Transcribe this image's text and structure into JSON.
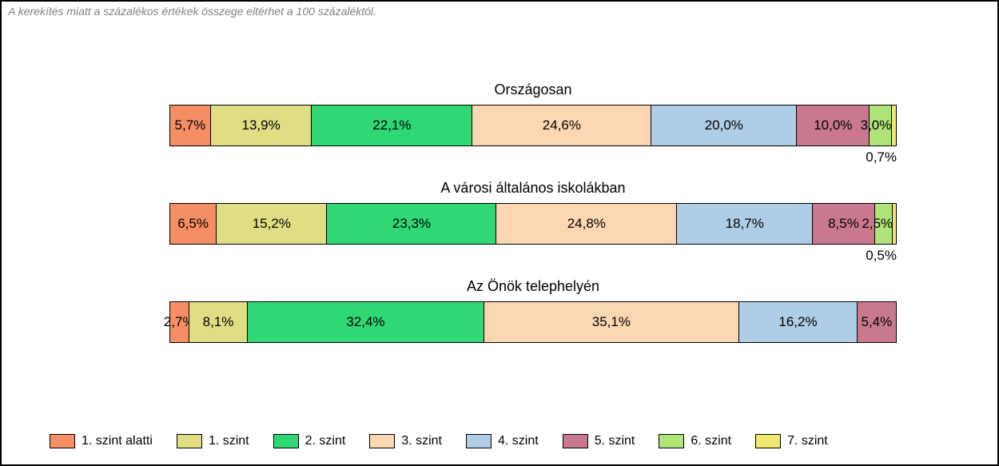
{
  "note": "A kerekítés miatt a százalékos értékek összege eltérhet a 100 százaléktól.",
  "levels": [
    {
      "name": "1. szint alatti",
      "color": "#f58e65"
    },
    {
      "name": "1. szint",
      "color": "#e0dd85"
    },
    {
      "name": "2. szint",
      "color": "#2fd875"
    },
    {
      "name": "3. szint",
      "color": "#fbd6b2"
    },
    {
      "name": "4. szint",
      "color": "#afcde6"
    },
    {
      "name": "5. szint",
      "color": "#ca7890"
    },
    {
      "name": "6. szint",
      "color": "#aee47a"
    },
    {
      "name": "7. szint",
      "color": "#efe86f"
    }
  ],
  "rows": [
    {
      "title": "Országosan",
      "values": [
        5.7,
        13.9,
        22.1,
        24.6,
        20.0,
        10.0,
        3.0,
        0.7
      ],
      "labels": [
        "5,7%",
        "13,9%",
        "22,1%",
        "24,6%",
        "20,0%",
        "10,0%",
        "3,0%",
        "0,7%"
      ],
      "overflowIndexFrom": 6
    },
    {
      "title": "A városi általános iskolákban",
      "values": [
        6.5,
        15.2,
        23.3,
        24.8,
        18.7,
        8.5,
        2.5,
        0.5
      ],
      "labels": [
        "6,5%",
        "15,2%",
        "23,3%",
        "24,8%",
        "18,7%",
        "8,5%",
        "2,5%",
        "0,5%"
      ],
      "overflowIndexFrom": 6
    },
    {
      "title": "Az Önök telephelyén",
      "values": [
        2.7,
        8.1,
        32.4,
        35.1,
        16.2,
        5.4
      ],
      "labels": [
        "2,7%",
        "8,1%",
        "32,4%",
        "35,1%",
        "16,2%",
        "5,4%"
      ],
      "overflowIndexFrom": 99
    }
  ],
  "chart_data": {
    "type": "bar",
    "stacked": true,
    "orientation": "horizontal",
    "unit": "percent",
    "note": "A kerekítés miatt a százalékos értékek összege eltérhet a 100 százaléktól.",
    "categories": [
      "Országosan",
      "A városi általános iskolákban",
      "Az Önök telephelyén"
    ],
    "series": [
      {
        "name": "1. szint alatti",
        "color": "#f58e65",
        "values": [
          5.7,
          6.5,
          2.7
        ]
      },
      {
        "name": "1. szint",
        "color": "#e0dd85",
        "values": [
          13.9,
          15.2,
          8.1
        ]
      },
      {
        "name": "2. szint",
        "color": "#2fd875",
        "values": [
          22.1,
          23.3,
          32.4
        ]
      },
      {
        "name": "3. szint",
        "color": "#fbd6b2",
        "values": [
          24.6,
          24.8,
          35.1
        ]
      },
      {
        "name": "4. szint",
        "color": "#afcde6",
        "values": [
          20.0,
          18.7,
          16.2
        ]
      },
      {
        "name": "5. szint",
        "color": "#ca7890",
        "values": [
          10.0,
          8.5,
          5.4
        ]
      },
      {
        "name": "6. szint",
        "color": "#aee47a",
        "values": [
          3.0,
          2.5,
          null
        ]
      },
      {
        "name": "7. szint",
        "color": "#efe86f",
        "values": [
          0.7,
          0.5,
          null
        ]
      }
    ],
    "xlim": [
      0,
      100
    ],
    "xlabel": "",
    "ylabel": ""
  }
}
